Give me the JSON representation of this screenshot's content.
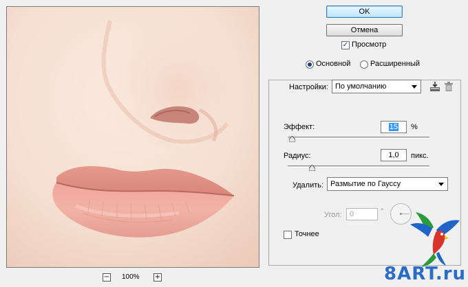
{
  "dialog": {
    "ok_label": "OK",
    "cancel_label": "Отмена",
    "preview_label": "Просмотр",
    "preview_checked": true,
    "mode_basic_label": "Основной",
    "mode_advanced_label": "Расширенный",
    "mode_selected": "basic"
  },
  "preview": {
    "zoom_text": "100%",
    "zoom_out_symbol": "−",
    "zoom_in_symbol": "+"
  },
  "settings": {
    "label": "Настройки:",
    "value": "По умолчанию",
    "save_icon": "save-settings-icon",
    "delete_icon": "trash-icon"
  },
  "effect": {
    "label": "Эффект:",
    "value": "15",
    "unit": "%",
    "slider_fraction": 0.03
  },
  "radius": {
    "label": "Радиус:",
    "value": "1,0",
    "unit": "пикс.",
    "slider_fraction": 0.17
  },
  "remove": {
    "label": "Удалить:",
    "value": "Размытие по Гауссу"
  },
  "angle": {
    "label": "Угол:",
    "value": "0",
    "unit": "°",
    "enabled": false
  },
  "accurate": {
    "label": "Точнее",
    "checked": false
  },
  "watermark": {
    "text": "8ART.ru"
  },
  "colors": {
    "accent": "#3c7fb1",
    "lips": "#e89a8c",
    "skin": "#f6e0d2",
    "watermark_blue": "#2a6dc9"
  }
}
